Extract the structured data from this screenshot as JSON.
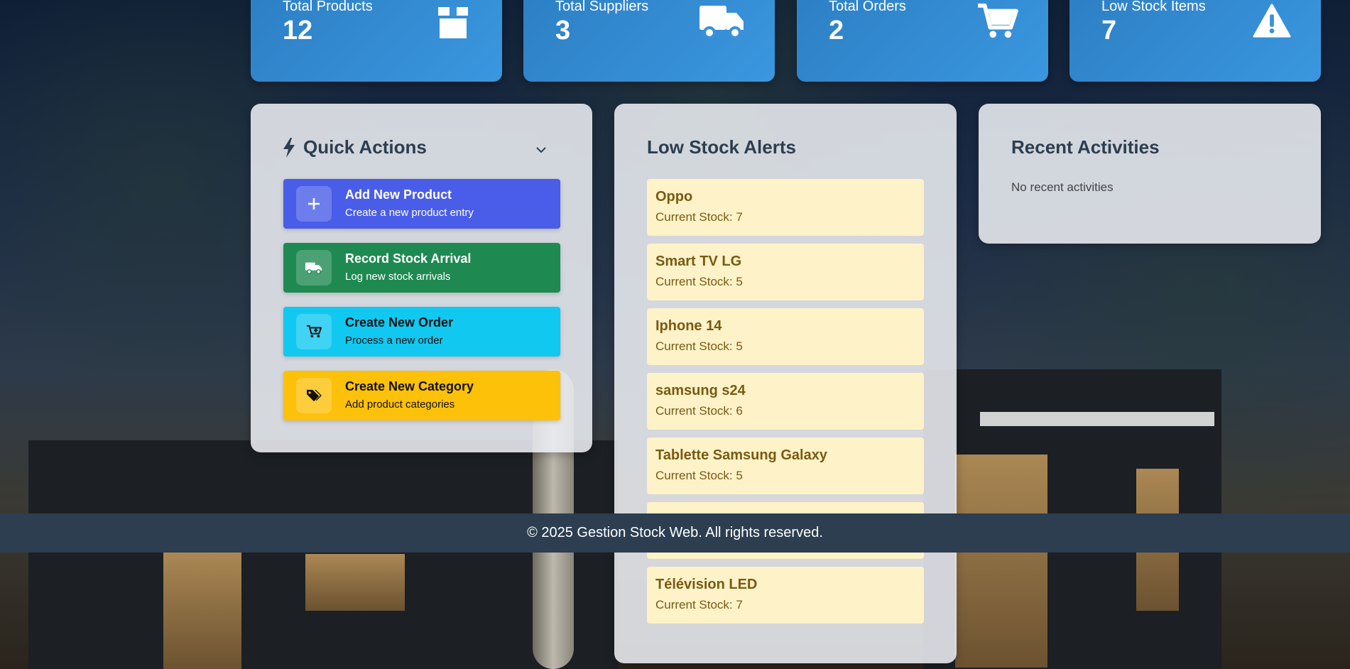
{
  "stats": [
    {
      "label": "Total Products",
      "value": "12",
      "icon": "box-icon"
    },
    {
      "label": "Total Suppliers",
      "value": "3",
      "icon": "truck-icon"
    },
    {
      "label": "Total Orders",
      "value": "2",
      "icon": "cart-icon"
    },
    {
      "label": "Low Stock Items",
      "value": "7",
      "icon": "warning-icon"
    }
  ],
  "quick_actions": {
    "title": "Quick Actions",
    "items": [
      {
        "title": "Add New Product",
        "subtitle": "Create a new product entry",
        "color": "#4a5de8",
        "icon": "plus-icon"
      },
      {
        "title": "Record Stock Arrival",
        "subtitle": "Log new stock arrivals",
        "color": "#1e8a52",
        "icon": "truck-icon"
      },
      {
        "title": "Create New Order",
        "subtitle": "Process a new order",
        "color": "#11c8f0",
        "icon": "cart-plus-icon"
      },
      {
        "title": "Create New Category",
        "subtitle": "Add product categories",
        "color": "#fdc10a",
        "icon": "tags-icon"
      }
    ]
  },
  "low_stock": {
    "title": "Low Stock Alerts",
    "items": [
      {
        "name": "Oppo",
        "stock": "Current Stock: 7"
      },
      {
        "name": "Smart TV LG",
        "stock": "Current Stock: 5"
      },
      {
        "name": "Iphone 14",
        "stock": "Current Stock: 5"
      },
      {
        "name": "samsung s24",
        "stock": "Current Stock: 6"
      },
      {
        "name": "Tablette Samsung Galaxy",
        "stock": "Current Stock: 5"
      },
      {
        "name": "Télévision LED",
        "stock": "Current Stock: 7"
      }
    ]
  },
  "recent_activities": {
    "title": "Recent Activities",
    "empty_text": "No recent activities"
  },
  "footer": {
    "text": "© 2025 Gestion Stock Web. All rights reserved."
  }
}
